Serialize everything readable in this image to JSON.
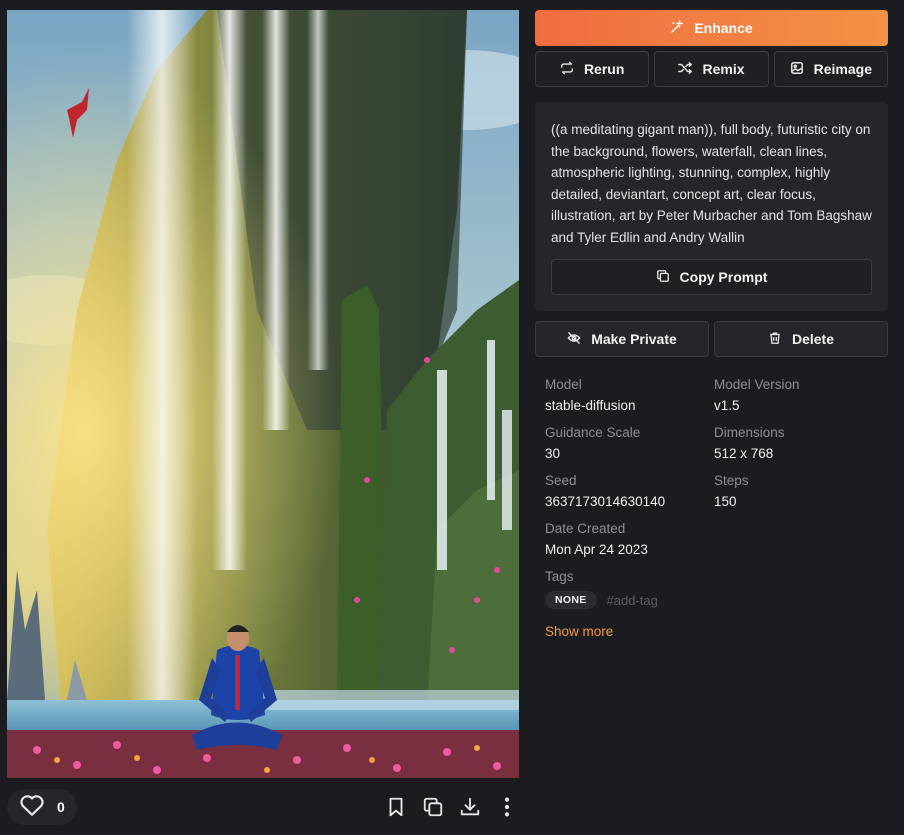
{
  "actions": {
    "enhance_label": "Enhance",
    "rerun_label": "Rerun",
    "remix_label": "Remix",
    "reimage_label": "Reimage",
    "copy_prompt_label": "Copy Prompt",
    "make_private_label": "Make Private",
    "delete_label": "Delete"
  },
  "prompt": "((a meditating gigant man)), full body, futuristic city on the background, flowers, waterfall, clean lines, atmospheric lighting, stunning, complex, highly detailed, deviantart, concept art, clear focus, illustration, art by Peter Murbacher and Tom Bagshaw and Tyler Edlin and Andry Wallin",
  "details": [
    {
      "label": "Model",
      "value": "stable-diffusion"
    },
    {
      "label": "Model Version",
      "value": "v1.5"
    },
    {
      "label": "Guidance Scale",
      "value": "30"
    },
    {
      "label": "Dimensions",
      "value": "512 x 768"
    },
    {
      "label": "Seed",
      "value": "3637173014630140"
    },
    {
      "label": "Steps",
      "value": "150"
    },
    {
      "label": "Date Created",
      "value": "Mon Apr 24 2023"
    }
  ],
  "tags": {
    "label": "Tags",
    "none_badge": "NONE",
    "add_placeholder": "#add-tag"
  },
  "show_more_label": "Show more",
  "image_toolbar": {
    "like_count": "0",
    "icons": [
      "heart-icon",
      "bookmark-icon",
      "copy-icon",
      "download-icon",
      "more-vertical-icon"
    ]
  },
  "colors": {
    "accent_orange": "#f39a3c",
    "enhance_gradient_start": "#f06d3f",
    "enhance_gradient_end": "#f39246",
    "background": "#1b1c20",
    "card": "#25262b"
  }
}
